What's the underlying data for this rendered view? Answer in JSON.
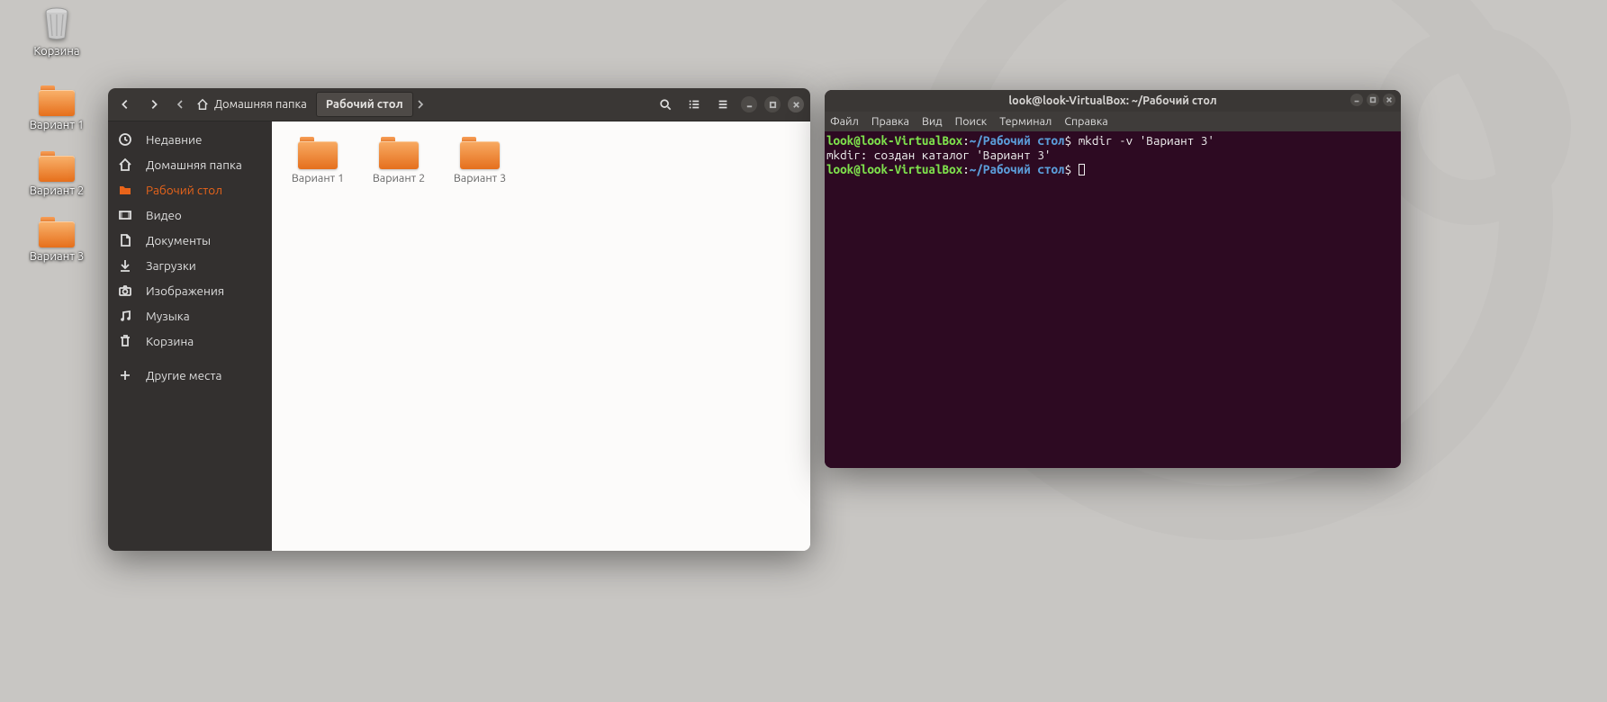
{
  "desktop": {
    "trash_label": "Корзина",
    "icons": [
      {
        "label": "Вариант 1"
      },
      {
        "label": "Вариант 2"
      },
      {
        "label": "Вариант 3"
      }
    ]
  },
  "fm": {
    "path": {
      "home_label": "Домашняя папка",
      "current_label": "Рабочий стол"
    },
    "sidebar": [
      {
        "icon": "clock",
        "label": "Недавние"
      },
      {
        "icon": "home",
        "label": "Домашняя папка"
      },
      {
        "icon": "folder",
        "label": "Рабочий стол",
        "active": true
      },
      {
        "icon": "video",
        "label": "Видео"
      },
      {
        "icon": "doc",
        "label": "Документы"
      },
      {
        "icon": "download",
        "label": "Загрузки"
      },
      {
        "icon": "camera",
        "label": "Изображения"
      },
      {
        "icon": "music",
        "label": "Музыка"
      },
      {
        "icon": "trash",
        "label": "Корзина"
      },
      {
        "icon": "plus",
        "label": "Другие места",
        "sep_before": true
      }
    ],
    "items": [
      {
        "label": "Вариант 1"
      },
      {
        "label": "Вариант 2"
      },
      {
        "label": "Вариант 3"
      }
    ]
  },
  "terminal": {
    "title": "look@look-VirtualBox: ~/Рабочий стол",
    "menu": [
      "Файл",
      "Правка",
      "Вид",
      "Поиск",
      "Терминал",
      "Справка"
    ],
    "lines": [
      {
        "user": "look@look-VirtualBox",
        "path": "~/Рабочий стол",
        "cmd": " mkdir -v 'Вариант 3'"
      },
      {
        "plain": "mkdir: создан каталог 'Вариант 3'"
      },
      {
        "user": "look@look-VirtualBox",
        "path": "~/Рабочий стол",
        "cmd": " ",
        "cursor": true
      }
    ]
  }
}
